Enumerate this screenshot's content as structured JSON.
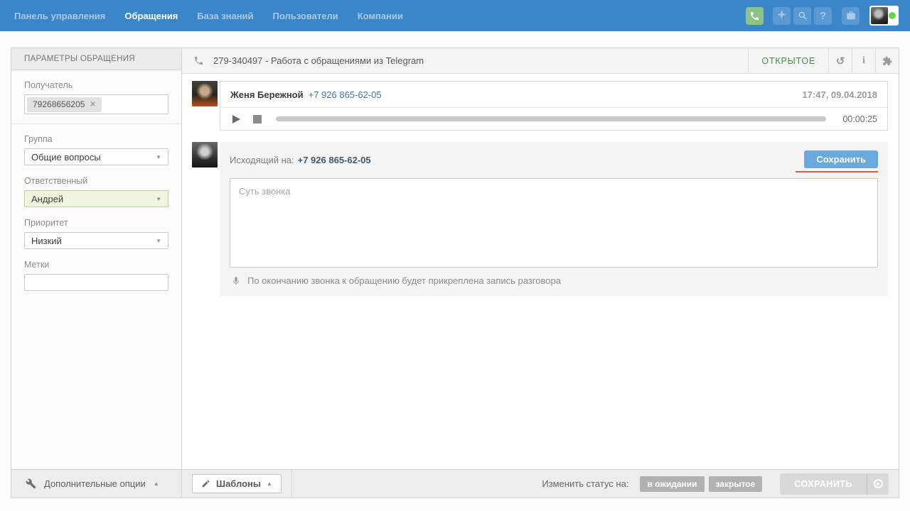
{
  "topnav": {
    "items": [
      {
        "label": "Панель управления"
      },
      {
        "label": "Обращения"
      },
      {
        "label": "База знаний"
      },
      {
        "label": "Пользователи"
      },
      {
        "label": "Компании"
      }
    ]
  },
  "sidebar": {
    "title": "ПАРАМЕТРЫ ОБРАЩЕНИЯ",
    "recipient": {
      "label": "Получатель",
      "chip": "79268656205"
    },
    "group": {
      "label": "Группа",
      "value": "Общие вопросы"
    },
    "assignee": {
      "label": "Ответственный",
      "value": "Андрей"
    },
    "priority": {
      "label": "Приоритет",
      "value": "Низкий"
    },
    "tags": {
      "label": "Метки",
      "value": ""
    },
    "footer_label": "Дополнительные опции"
  },
  "ticket": {
    "title": "279-340497 - Работа с обращениями из Telegram",
    "status": "ОТКРЫТОЕ"
  },
  "call_message": {
    "author": "Женя Бережной",
    "phone": "+7 926 865-62-05",
    "timestamp": "17:47, 09.04.2018",
    "duration": "00:00:25"
  },
  "composer": {
    "direction_label": "Исходящий на:",
    "phone": "+7 926 865-62-05",
    "save_label": "Сохранить",
    "placeholder": "Суть звонка",
    "note": "По окончанию звонка к обращению будет прикреплена запись разговора"
  },
  "footer": {
    "templates_label": "Шаблоны",
    "change_status_label": "Изменить статус на:",
    "status_pending": "в ожидании",
    "status_closed": "закрытое",
    "save_label": "СОХРАНИТЬ"
  },
  "icons": {
    "plus": "+",
    "question": "?",
    "history": "↺",
    "info": "i",
    "dropdown_arrow": "▼",
    "collapse_arrow": "▲",
    "close": "✕"
  },
  "colors": {
    "nav_blue": "#3a86c8",
    "phone_green": "#8fc287",
    "status_open_green": "#3f9142",
    "link_blue": "#3e77b6",
    "save_button_blue": "#69a9db",
    "underline_orange": "#e0593c",
    "assignee_bg_green": "#eef7de",
    "online_dot_green": "#6ed14f"
  }
}
